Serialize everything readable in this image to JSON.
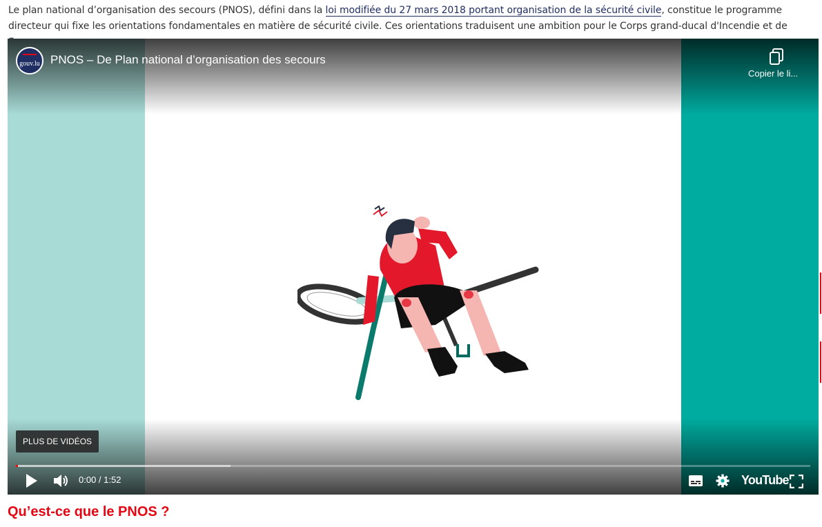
{
  "intro": {
    "text_before": "Le plan national d’organisation des secours (PNOS), défini dans la ",
    "link_text": "loi modifiée du 27 mars 2018 portant organisation de la sécurité civile",
    "text_after": ", constitue le programme directeur qui fixe les orientations fondamentales en matière de sécurité civile. Ces orientations traduisent une ambition pour le Corps grand-ducal d'Incendie et de Secours."
  },
  "video": {
    "channel_logo_text": "gouv.lu",
    "title": "PNOS – De Plan national d’organisation des secours",
    "copy_link_label": "Copier le li...",
    "more_videos_label": "PLUS DE VIDÉOS",
    "time": "0:00 / 1:52",
    "progress": {
      "played_fraction": 0.002,
      "buffered_fraction": 0.27
    },
    "youtube_logo": "YouTube",
    "colors": {
      "left_band": "#a8dbd6",
      "right_band": "#00ab9f",
      "progress": "#ff0000"
    },
    "icons": [
      "play-icon",
      "volume-icon",
      "subtitles-icon",
      "settings-icon",
      "fullscreen-icon",
      "copy-icon"
    ]
  },
  "section": {
    "heading": "Qu’est-ce que le PNOS ?"
  },
  "brand": {
    "accent": "#e30613",
    "link": "#1f2f63"
  }
}
